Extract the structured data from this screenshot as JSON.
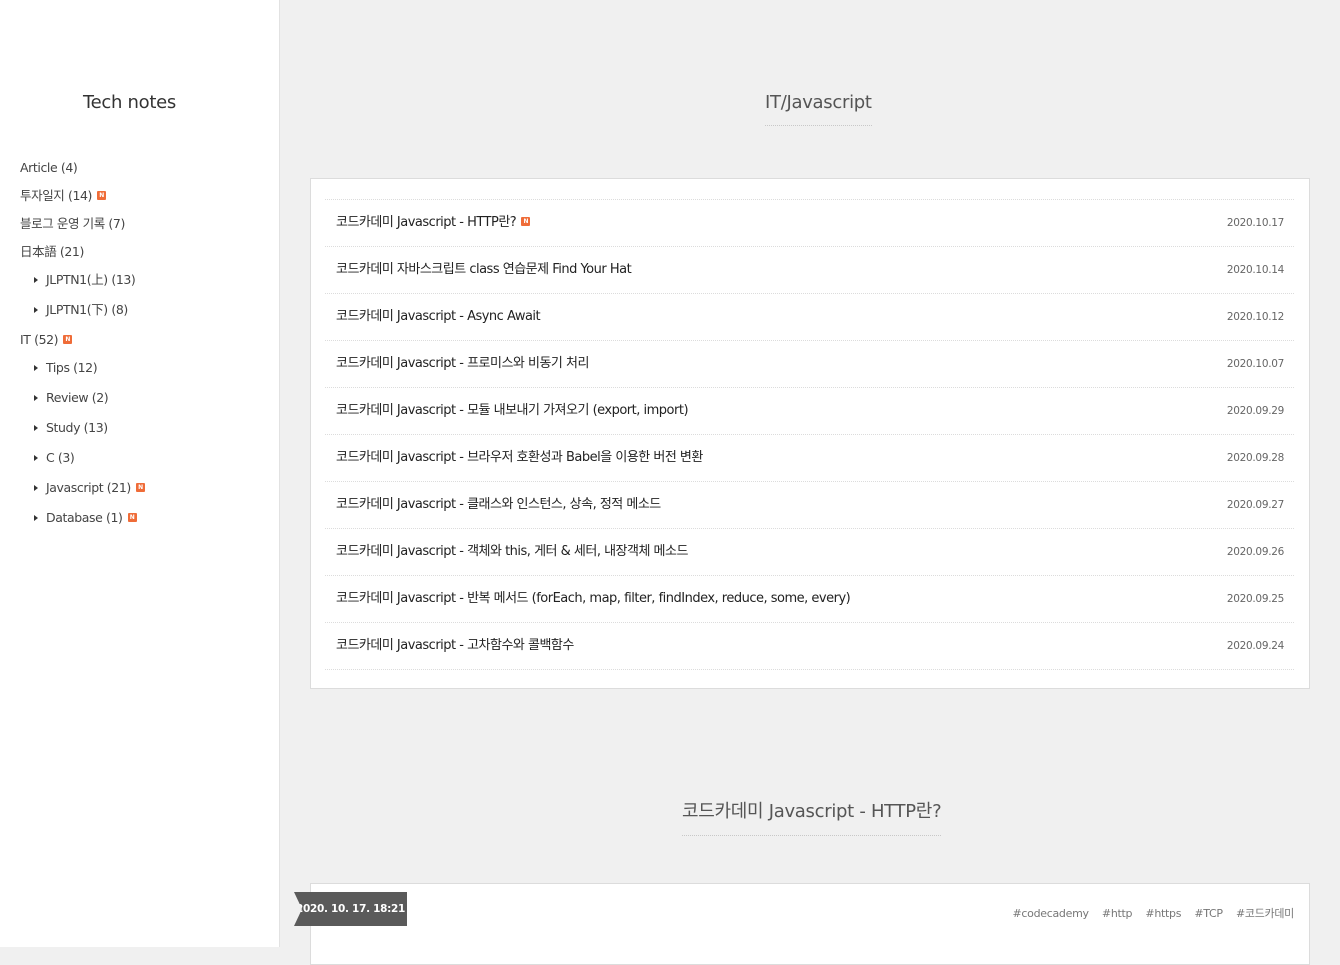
{
  "sidebar": {
    "blog_title": "Tech notes",
    "new_badge": "N",
    "categories": [
      {
        "label": "Article (4)"
      },
      {
        "label": "투자일지 (14)"
      },
      {
        "label": "블로그 운영 기록 (7)"
      },
      {
        "label": "日本語 (21)"
      },
      {
        "label": "JLPTN1(上) (13)"
      },
      {
        "label": "JLPTN1(下) (8)"
      },
      {
        "label": "IT (52)"
      },
      {
        "label": "Tips (12)"
      },
      {
        "label": "Review (2)"
      },
      {
        "label": "Study (13)"
      },
      {
        "label": "C (3)"
      },
      {
        "label": "Javascript (21)"
      },
      {
        "label": "Database (1)"
      }
    ]
  },
  "main": {
    "category_title": "IT/Javascript",
    "posts": [
      {
        "title": "코드카데미 Javascript - HTTP란?",
        "date": "2020.10.17"
      },
      {
        "title": "코드카데미 자바스크립트 class 연습문제 Find Your Hat",
        "date": "2020.10.14"
      },
      {
        "title": "코드카데미 Javascript - Async Await",
        "date": "2020.10.12"
      },
      {
        "title": "코드카데미 Javascript - 프로미스와 비동기 처리",
        "date": "2020.10.07"
      },
      {
        "title": "코드카데미 Javascript - 모듈 내보내기 가져오기 (export, import)",
        "date": "2020.09.29"
      },
      {
        "title": "코드카데미 Javascript - 브라우저 호환성과 Babel을 이용한 버전 변환",
        "date": "2020.09.28"
      },
      {
        "title": "코드카데미 Javascript - 클래스와 인스턴스, 상속, 정적 메소드",
        "date": "2020.09.27"
      },
      {
        "title": "코드카데미 Javascript - 객체와 this, 게터 & 세터, 내장객체 메소드",
        "date": "2020.09.26"
      },
      {
        "title": "코드카데미 Javascript - 반복 메서드 (forEach, map, filter, findIndex, reduce, some, every)",
        "date": "2020.09.25"
      },
      {
        "title": "코드카데미 Javascript - 고차함수와 콜백함수",
        "date": "2020.09.24"
      }
    ],
    "article": {
      "title": "코드카데미 Javascript - HTTP란?",
      "datetime": "2020. 10. 17. 18:21",
      "tags": [
        "#codecademy",
        "#http",
        "#https",
        "#TCP",
        "#코드카데미"
      ]
    }
  }
}
